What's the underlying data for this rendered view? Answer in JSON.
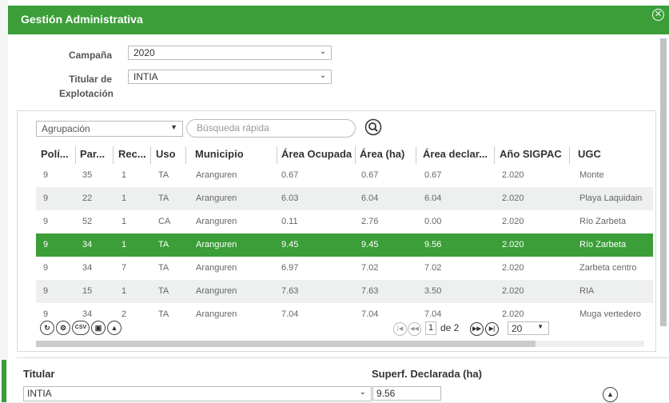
{
  "modal": {
    "title": "Gestión Administrativa",
    "close_icon": "close-circle-icon",
    "accent": "#3b9e38"
  },
  "filters": {
    "campana_label": "Campaña",
    "campana_value": "2020",
    "titular_label_line1": "Titular de",
    "titular_label_line2": "Explotación",
    "titular_value": "INTIA"
  },
  "grid": {
    "agrupacion_value": "Agrupación",
    "search_placeholder": "Búsqueda rápida",
    "columns": [
      "Polí...",
      "Par...",
      "Rec...",
      "Uso",
      "Municipio",
      "Área Ocupada",
      "Área (ha)",
      "Área declar...",
      "Año SIGPAC",
      "UGC"
    ],
    "rows": [
      [
        "9",
        "35",
        "1",
        "TA",
        "Aranguren",
        "0.67",
        "0.67",
        "0.67",
        "2.020",
        "Monte"
      ],
      [
        "9",
        "22",
        "1",
        "TA",
        "Aranguren",
        "6.03",
        "6.04",
        "6.04",
        "2.020",
        "Playa Laquidain"
      ],
      [
        "9",
        "52",
        "1",
        "CA",
        "Aranguren",
        "0.11",
        "2.76",
        "0.00",
        "2.020",
        "Río Zarbeta"
      ],
      [
        "9",
        "34",
        "1",
        "TA",
        "Aranguren",
        "9.45",
        "9.45",
        "9.56",
        "2.020",
        "Río Zarbeta"
      ],
      [
        "9",
        "34",
        "7",
        "TA",
        "Aranguren",
        "6.97",
        "7.02",
        "7.02",
        "2.020",
        "Zarbeta centro"
      ],
      [
        "9",
        "15",
        "1",
        "TA",
        "Aranguren",
        "7.63",
        "7.63",
        "3.50",
        "2.020",
        "RIA"
      ],
      [
        "9",
        "34",
        "2",
        "TA",
        "Aranguren",
        "7.04",
        "7.04",
        "7.04",
        "2.020",
        "Muga vertedero"
      ]
    ],
    "selected_row": 3,
    "toolbar": [
      "refresh-icon",
      "settings-icon",
      "csv-icon",
      "save-icon",
      "delete-icon"
    ],
    "toolbar_csv_label": "CSV",
    "pager": {
      "current_page": "1",
      "of_label": "de 2",
      "page_size": "20"
    }
  },
  "bottom": {
    "titular_label": "Titular",
    "titular_value": "INTIA",
    "superficie_label": "Superf. Declarada (ha)",
    "superficie_value": "9.56"
  }
}
